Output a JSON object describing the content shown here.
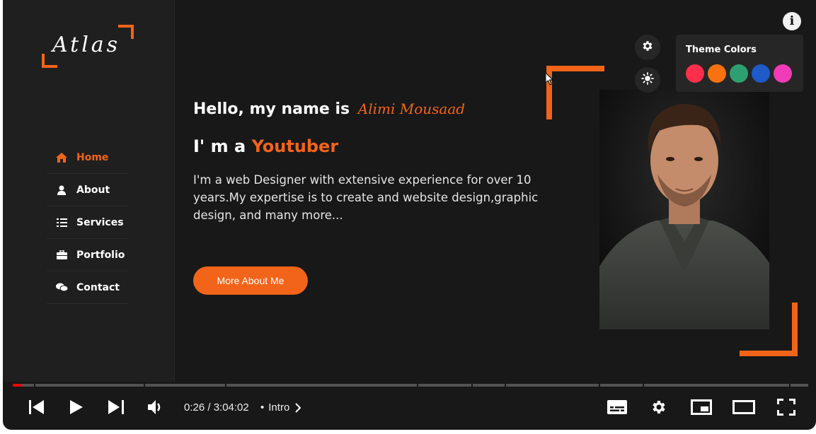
{
  "site": {
    "logo": "Atlas",
    "nav": [
      {
        "label": "Home",
        "icon": "home-icon",
        "active": true
      },
      {
        "label": "About",
        "icon": "user-icon",
        "active": false
      },
      {
        "label": "Services",
        "icon": "list-icon",
        "active": false
      },
      {
        "label": "Portfolio",
        "icon": "briefcase-icon",
        "active": false
      },
      {
        "label": "Contact",
        "icon": "chat-icon",
        "active": false
      }
    ],
    "greeting": "Hello, my name is",
    "name": "Alimi Mousaad",
    "role_prefix": "I' m a",
    "role": "Youtuber",
    "description": "I'm a web Designer with extensive experience for over 10 years.My expertise is to create and website design,graphic design, and many more...",
    "cta_label": "More About Me",
    "theme_panel": {
      "title": "Theme Colors",
      "colors": [
        "#ff2e4a",
        "#f8720f",
        "#2e9f70",
        "#1e5ac8",
        "#f23bb8"
      ]
    },
    "accent_color": "#f26419"
  },
  "player": {
    "info_label": "i",
    "time_current": "0:26",
    "time_total": "3:04:02",
    "time_display": "0:26 / 3:04:02",
    "separator": "•",
    "chapter": "Intro",
    "progress_fraction": 0.0024,
    "controls": [
      "previous-icon",
      "play-icon",
      "next-icon",
      "volume-icon",
      "subtitles-icon",
      "settings-icon",
      "miniplayer-icon",
      "theater-icon",
      "fullscreen-icon"
    ]
  }
}
